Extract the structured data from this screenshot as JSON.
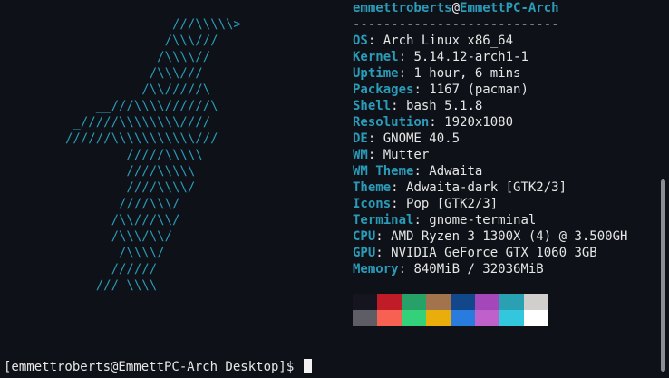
{
  "ascii_art": "              ///\\\\\\\\\\>\n             /\\\\\\///\n            /\\\\\\\\//\n           /\\\\\\///\n          /\\\\/////\\\n    __///\\\\\\\\//////\\\n _/////\\\\\\\\\\\\\\\\////\n//////\\\\\\\\\\\\\\\\\\\\\\///\n        /////\\\\\\\\\\\n        ////\\\\\\\\\\\n        ////\\\\\\\\/\n       ////\\\\\\/\n      /\\\\///\\\\/\n      /\\\\\\/\\\\/\n       /\\\\\\\\/\n      //////\n    /// \\\\\\\\",
  "header": {
    "user": "emmettroberts",
    "at": "@",
    "host": "EmmettPC-Arch",
    "separator": "---------------------------"
  },
  "info": [
    {
      "key": "OS",
      "value": "Arch Linux x86_64"
    },
    {
      "key": "Kernel",
      "value": "5.14.12-arch1-1"
    },
    {
      "key": "Uptime",
      "value": "1 hour, 6 mins"
    },
    {
      "key": "Packages",
      "value": "1167 (pacman)"
    },
    {
      "key": "Shell",
      "value": "bash 5.1.8"
    },
    {
      "key": "Resolution",
      "value": "1920x1080"
    },
    {
      "key": "DE",
      "value": "GNOME 40.5"
    },
    {
      "key": "WM",
      "value": "Mutter"
    },
    {
      "key": "WM Theme",
      "value": "Adwaita"
    },
    {
      "key": "Theme",
      "value": "Adwaita-dark [GTK2/3]"
    },
    {
      "key": "Icons",
      "value": "Pop [GTK2/3]"
    },
    {
      "key": "Terminal",
      "value": "gnome-terminal"
    },
    {
      "key": "CPU",
      "value": "AMD Ryzen 3 1300X (4) @ 3.500GH"
    },
    {
      "key": "GPU",
      "value": "NVIDIA GeForce GTX 1060 3GB"
    },
    {
      "key": "Memory",
      "value": "840MiB / 32036MiB"
    }
  ],
  "colon": ": ",
  "palette": {
    "normal": [
      "#151520",
      "#c01c28",
      "#26a269",
      "#a2734c",
      "#12488b",
      "#a347ba",
      "#2aa1b3",
      "#d0cfcc"
    ],
    "bright": [
      "#5e5c64",
      "#f66151",
      "#33d17a",
      "#e9ad0c",
      "#2a7bde",
      "#c061cb",
      "#33c7de",
      "#ffffff"
    ]
  },
  "prompt": "[emmettroberts@EmmettPC-Arch Desktop]$ "
}
